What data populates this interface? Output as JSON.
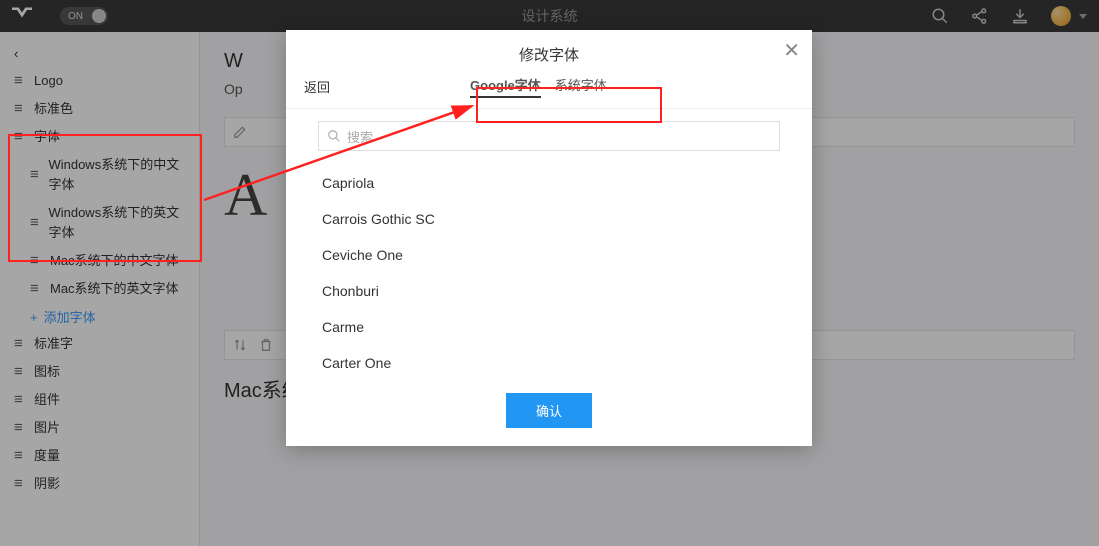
{
  "topbar": {
    "toggle_label": "ON",
    "title": "设计系统"
  },
  "sidebar": {
    "back": "‹",
    "items": [
      {
        "label": "Logo"
      },
      {
        "label": "标准色"
      },
      {
        "label": "字体"
      },
      {
        "label": "Windows系统下的中文字体",
        "child": true
      },
      {
        "label": "Windows系统下的英文字体",
        "child": true
      },
      {
        "label": "Mac系统下的中文字体",
        "child": true
      },
      {
        "label": "Mac系统下的英文字体",
        "child": true
      }
    ],
    "add_font": "添加字体",
    "rest": [
      {
        "label": "标准字"
      },
      {
        "label": "图标"
      },
      {
        "label": "组件"
      },
      {
        "label": "图片"
      },
      {
        "label": "度量"
      },
      {
        "label": "阴影"
      }
    ]
  },
  "content": {
    "heading_partial": "W",
    "op_partial": "Op",
    "big_letter": "A",
    "section2": "Mac系统下的中文字体"
  },
  "modal": {
    "title": "修改字体",
    "back": "返回",
    "tab_google": "Google字体",
    "tab_system": "系统字体",
    "search_placeholder": "搜索",
    "fonts": [
      "Capriola",
      "Carrois Gothic SC",
      "Ceviche One",
      "Chonburi",
      "Carme",
      "Carter One"
    ],
    "confirm": "确认"
  }
}
